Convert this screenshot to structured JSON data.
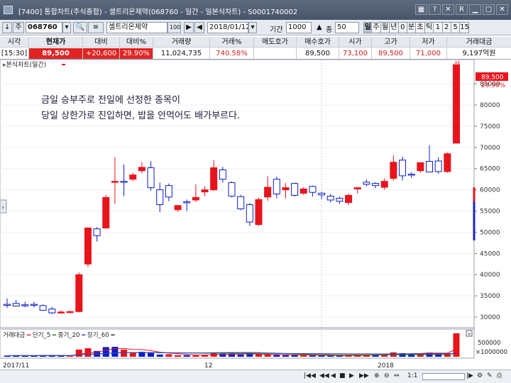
{
  "window": {
    "title": "[7400] 통합차트(주식종합) - 셀트리온제약(068760 - 일간 - 일본식차트) - S0001740002",
    "buttons": [
      "▦",
      "?",
      "✕",
      "R",
      "▁",
      "▢",
      "✕"
    ]
  },
  "toolbar": {
    "code": "068760",
    "name": "셀트리온제약",
    "name_badge": "100",
    "date": "2018/01/12",
    "period_label": "기간",
    "period_value": "1000",
    "count_label": "종",
    "count_value": "50",
    "periods": [
      "일",
      "주",
      "월",
      "년",
      "0",
      "분",
      "초",
      "틱",
      "1",
      "2",
      "5",
      "15"
    ]
  },
  "quote": {
    "headers": [
      "시각",
      "현재가",
      "대비",
      "대비%",
      "거래량",
      "거래%",
      "매도호가",
      "매수호가",
      "시가",
      "고가",
      "저가",
      "거래대금"
    ],
    "values": [
      "[15:30]",
      "89,500",
      "+20,600",
      "29.90%",
      "11,024,735",
      "740.58%",
      "",
      "89,500",
      "73,100",
      "89,500",
      "71,000",
      "9,197억원"
    ]
  },
  "annotation": {
    "line1": "금일 승부주로 전일에 선정한 종목이",
    "line2": "당일 상한가로 진입하면, 밥을 안먹어도 배가부르다."
  },
  "main_pane": {
    "label": "본식차트(일간)",
    "current_price": "89,500",
    "current_pct": "29.90%",
    "limit_up_marker": "상"
  },
  "volume_pane": {
    "legend": {
      "title": "거래대금",
      "short": "단기_5",
      "mid": "중기_20",
      "long": "장기_60"
    },
    "axis_labels": [
      "500000",
      "×1000000"
    ]
  },
  "x_axis_labels": [
    "2017/11",
    "12",
    "2018"
  ],
  "bottom": {
    "ratio": "1:1"
  },
  "colors": {
    "up": "#e8141c",
    "down": "#0b1dc8",
    "ma5": "#e8141c",
    "ma20": "#1f7a1f",
    "ma60": "#2b3fd0"
  },
  "chart_data": [
    {
      "type": "candlestick",
      "title": "본식차트(일간)",
      "y_ticks": [
        30000,
        35000,
        40000,
        45000,
        50000,
        55000,
        60000,
        65000,
        70000,
        75000,
        80000,
        85000
      ],
      "ylim": [
        27500,
        90700
      ],
      "candles": [
        {
          "o": 33000,
          "h": 34400,
          "l": 32200,
          "c": 32900
        },
        {
          "o": 33200,
          "h": 34000,
          "l": 32600,
          "c": 32600
        },
        {
          "o": 32900,
          "h": 33600,
          "l": 32300,
          "c": 32700
        },
        {
          "o": 33000,
          "h": 33600,
          "l": 32300,
          "c": 32800
        },
        {
          "o": 32700,
          "h": 33000,
          "l": 31500,
          "c": 31600
        },
        {
          "o": 31900,
          "h": 32400,
          "l": 30700,
          "c": 31000
        },
        {
          "o": 31200,
          "h": 31600,
          "l": 30800,
          "c": 31200
        },
        {
          "o": 31100,
          "h": 31500,
          "l": 30900,
          "c": 31300
        },
        {
          "o": 31300,
          "h": 40500,
          "l": 31100,
          "c": 40000
        },
        {
          "o": 42500,
          "h": 51200,
          "l": 41800,
          "c": 51000
        },
        {
          "o": 50800,
          "h": 51200,
          "l": 47800,
          "c": 49200
        },
        {
          "o": 51000,
          "h": 58800,
          "l": 50800,
          "c": 58200
        },
        {
          "o": 62000,
          "h": 67700,
          "l": 56700,
          "c": 62000
        },
        {
          "o": 62000,
          "h": 66000,
          "l": 58500,
          "c": 61900
        },
        {
          "o": 62500,
          "h": 64000,
          "l": 62000,
          "c": 63500
        },
        {
          "o": 64500,
          "h": 66500,
          "l": 63900,
          "c": 65300
        },
        {
          "o": 65200,
          "h": 66700,
          "l": 59800,
          "c": 60500
        },
        {
          "o": 60000,
          "h": 61700,
          "l": 54700,
          "c": 56500
        },
        {
          "o": 61000,
          "h": 61500,
          "l": 57300,
          "c": 58300
        },
        {
          "o": 55300,
          "h": 56000,
          "l": 54800,
          "c": 56300
        },
        {
          "o": 57200,
          "h": 57700,
          "l": 55000,
          "c": 57100
        },
        {
          "o": 57600,
          "h": 61300,
          "l": 57100,
          "c": 58200
        },
        {
          "o": 59500,
          "h": 60800,
          "l": 58500,
          "c": 60000
        },
        {
          "o": 60000,
          "h": 67000,
          "l": 59700,
          "c": 65200
        },
        {
          "o": 64700,
          "h": 65400,
          "l": 61700,
          "c": 62500
        },
        {
          "o": 61700,
          "h": 62000,
          "l": 58200,
          "c": 58500
        },
        {
          "o": 58400,
          "h": 58800,
          "l": 55200,
          "c": 55500
        },
        {
          "o": 56500,
          "h": 56900,
          "l": 51500,
          "c": 52400
        },
        {
          "o": 51800,
          "h": 58200,
          "l": 51500,
          "c": 57700
        },
        {
          "o": 58300,
          "h": 63200,
          "l": 57400,
          "c": 60600
        },
        {
          "o": 62500,
          "h": 63100,
          "l": 58000,
          "c": 59000
        },
        {
          "o": 60000,
          "h": 61600,
          "l": 58000,
          "c": 60500
        },
        {
          "o": 61500,
          "h": 61700,
          "l": 58400,
          "c": 58700
        },
        {
          "o": 59200,
          "h": 60600,
          "l": 58800,
          "c": 60200
        },
        {
          "o": 60800,
          "h": 61000,
          "l": 58400,
          "c": 59400
        },
        {
          "o": 59200,
          "h": 59500,
          "l": 57800,
          "c": 58800
        },
        {
          "o": 58500,
          "h": 59000,
          "l": 57000,
          "c": 57600
        },
        {
          "o": 58000,
          "h": 58400,
          "l": 56700,
          "c": 57300
        },
        {
          "o": 57000,
          "h": 59100,
          "l": 56400,
          "c": 58700
        },
        {
          "o": 60200,
          "h": 60600,
          "l": 59100,
          "c": 60500
        },
        {
          "o": 61800,
          "h": 62400,
          "l": 60800,
          "c": 61300
        },
        {
          "o": 61500,
          "h": 61800,
          "l": 60400,
          "c": 61000
        },
        {
          "o": 60600,
          "h": 62700,
          "l": 60000,
          "c": 62000
        },
        {
          "o": 62700,
          "h": 68100,
          "l": 62200,
          "c": 66500
        },
        {
          "o": 67000,
          "h": 67800,
          "l": 62200,
          "c": 63300
        },
        {
          "o": 63700,
          "h": 64100,
          "l": 62800,
          "c": 63500
        },
        {
          "o": 64500,
          "h": 66000,
          "l": 64000,
          "c": 66400
        },
        {
          "o": 66700,
          "h": 70500,
          "l": 66300,
          "c": 64200
        },
        {
          "o": 66800,
          "h": 67700,
          "l": 63800,
          "c": 64300
        },
        {
          "o": 64300,
          "h": 68800,
          "l": 64000,
          "c": 68500
        },
        {
          "o": 71000,
          "h": 89500,
          "l": 71000,
          "c": 89500
        }
      ]
    },
    {
      "type": "bar",
      "title": "거래대금",
      "series_names": [
        "단기_5",
        "중기_20",
        "장기_60"
      ],
      "y_ticks": [
        500000
      ],
      "ylim": [
        0,
        950000
      ],
      "values": [
        40000,
        45000,
        40000,
        45000,
        55000,
        55000,
        35000,
        30000,
        260000,
        310000,
        210000,
        350000,
        360000,
        260000,
        150000,
        180000,
        160000,
        80000,
        90000,
        60000,
        60000,
        55000,
        50000,
        140000,
        110000,
        110000,
        80000,
        90000,
        90000,
        80000,
        70000,
        60000,
        60000,
        50000,
        50000,
        45000,
        40000,
        40000,
        55000,
        65000,
        70000,
        80000,
        70000,
        160000,
        130000,
        110000,
        120000,
        150000,
        140000,
        130000,
        850000
      ],
      "colors": [
        "d",
        "d",
        "d",
        "d",
        "d",
        "d",
        "d",
        "u",
        "u",
        "u",
        "d",
        "d",
        "d",
        "u",
        "u",
        "d",
        "d",
        "d",
        "u",
        "u",
        "d",
        "u",
        "u",
        "u",
        "d",
        "d",
        "d",
        "d",
        "u",
        "u",
        "d",
        "d",
        "d",
        "u",
        "d",
        "d",
        "d",
        "d",
        "u",
        "u",
        "u",
        "d",
        "u",
        "u",
        "d",
        "d",
        "u",
        "d",
        "d",
        "u",
        "u"
      ]
    }
  ]
}
